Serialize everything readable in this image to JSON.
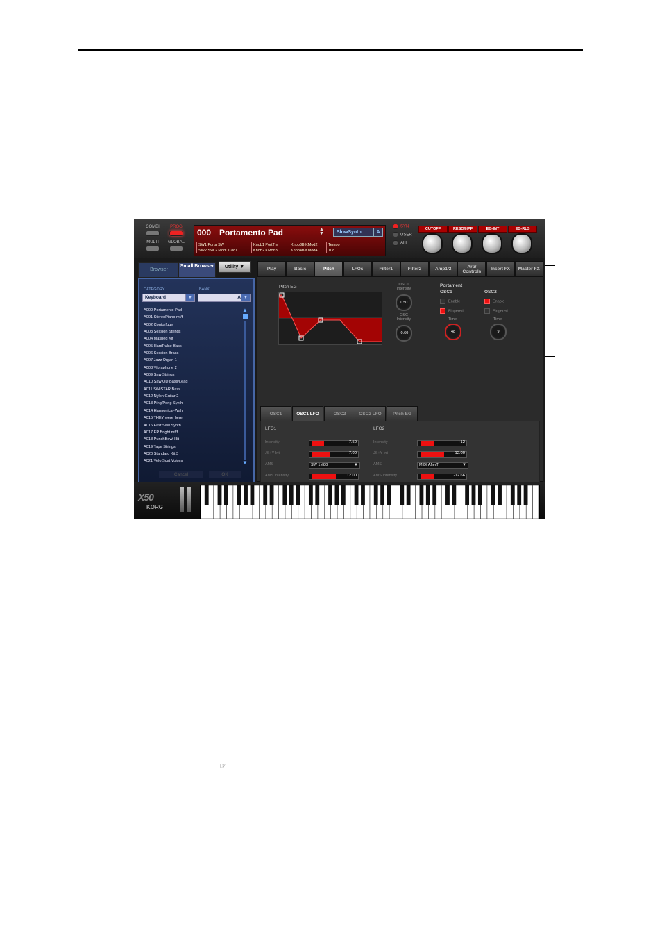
{
  "synth": {
    "modes": [
      {
        "label": "COMBI",
        "active": false
      },
      {
        "label": "PROG",
        "active": true
      },
      {
        "label": "MULTI",
        "active": false
      },
      {
        "label": "GLOBAL",
        "active": false
      }
    ],
    "display": {
      "program_number": "000",
      "program_name": "Portamento Pad",
      "category": "SlowSynth",
      "bank": "A",
      "cells": [
        [
          "SW1  Porta SW",
          "SW2 SW 2 ModCC#81"
        ],
        [
          "Knob1  PortTm",
          "Knob2  KMod3"
        ],
        [
          "Knob3B KMod2",
          "Knob4B KMod4"
        ],
        [
          "Tempo",
          "108"
        ]
      ]
    },
    "sources": [
      {
        "label": "SYN",
        "on": true
      },
      {
        "label": "USER",
        "on": false
      },
      {
        "label": "ALL",
        "on": false
      }
    ],
    "knobs": [
      "CUTOFF",
      "RESO/HPF",
      "EG-INT",
      "EG-RLS"
    ],
    "browser": {
      "tabs": [
        "Browser",
        "Small Browser"
      ],
      "utility_label": "Utility",
      "category_label": "CATEGORY",
      "category_value": "Keyboard",
      "bank_label": "BANK",
      "bank_value": "A",
      "programs": [
        "A000 Portamento Pad",
        "A001 StereoPiano mf/f",
        "A002 Contorfuge",
        "A003 Session Strings",
        "A004 Mashed Kit",
        "A005 HardPulse Bass",
        "A006 Session Brass",
        "A007 Jazz Organ 1",
        "A008 Vibraphone 2",
        "A009 Saw Strings",
        "A010 Saw OD Bass/Lead",
        "A011 SiNiSTAR Bass",
        "A012 Nylon Guitar 2",
        "A013 Ping/Pong Synth",
        "A014 Harmonica~Wah",
        "A015 THEY were here",
        "A016 Fast Saw Synth",
        "A017 EP Bright mf/f",
        "A018 PunchBowl Hit",
        "A019 Tape Strings",
        "A020 Standard Kit 3",
        "A021 Velo Scat Voices"
      ],
      "cancel_label": "Cancel",
      "ok_label": "OK"
    },
    "tabs": [
      "Play",
      "Basic",
      "Pitch",
      "LFOs",
      "Filter1",
      "Filter2",
      "Amp1/2",
      "Arp/ Controls",
      "Insert FX",
      "Master FX"
    ],
    "active_tab": "Pitch",
    "pitch": {
      "eg_label": "Pitch EG",
      "osc1_intensity_label": "OSC1 Intensity",
      "osc1_intensity_value": "0.50",
      "osc2_intensity_label": "OSC Intensity",
      "osc2_intensity_value": "-0.60",
      "portament_label": "Portament",
      "osc1_label": "OSC1",
      "osc2_label": "OSC2",
      "enable_label": "Enable",
      "fingered_label": "Fingered",
      "time_label": "Time",
      "osc1_time": "48",
      "osc2_time": "9"
    },
    "subtabs": [
      "OSC1",
      "OSC1 LFO",
      "OSC2",
      "OSC2 LFO",
      "Pitch EG"
    ],
    "active_subtab": "OSC1 LFO",
    "lfo1": {
      "title": "LFO1",
      "intensity_label": "Intensity",
      "intensity_value": "-7.50",
      "intensity_fill": 0.3,
      "jsy_label": "JS+Y Int",
      "jsy_value": "7.00",
      "jsy_fill": 0.45,
      "ams_label": "AMS",
      "ams_value": "SW 1 #80",
      "amsint_label": "AMS Intensity",
      "amsint_value": "12.00",
      "amsint_fill": 0.6
    },
    "lfo2": {
      "title": "LFO2",
      "intensity_label": "Intensity",
      "intensity_value": "+12",
      "intensity_fill": 0.35,
      "jsy_label": "JS+Y Int",
      "jsy_value": "12.00",
      "jsy_fill": 0.6,
      "ams_label": "AMS",
      "ams_value": "MIDI AfterT",
      "amsint_label": "AMS Intensity",
      "amsint_value": "-12.66",
      "amsint_fill": 0.35
    },
    "logo": "X50",
    "brand": "KORG"
  },
  "footnote_icon": "pointing-hand-icon"
}
